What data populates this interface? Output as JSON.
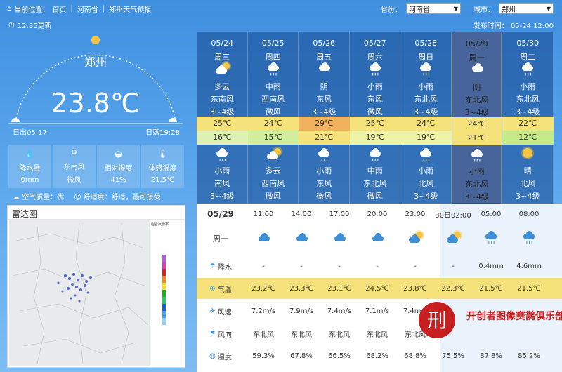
{
  "breadcrumb": {
    "prefix": "当前位置：",
    "items": [
      "首页",
      "河南省",
      "郑州天气预报"
    ]
  },
  "selectors": {
    "province_label": "省份：",
    "province_value": "河南省",
    "city_label": "城市：",
    "city_value": "郑州"
  },
  "updated": "12:35更新",
  "publish": "发布时间：  05-24 12:00",
  "current": {
    "city": "郑州",
    "temp": "23.8℃",
    "sunrise": "日出05:17",
    "sunset": "日落19:28"
  },
  "stats": [
    {
      "icon": "rain-drop-icon",
      "label": "降水量",
      "value": "0mm"
    },
    {
      "icon": "wind-icon",
      "label": "东南风",
      "value": "微风"
    },
    {
      "icon": "humidity-icon",
      "label": "相对湿度",
      "value": "41%"
    },
    {
      "icon": "thermometer-icon",
      "label": "体感温度",
      "value": "21.5℃"
    }
  ],
  "air": {
    "quality": "空气质量：优",
    "comfort": "舒适度：舒适，最可接受"
  },
  "radar": {
    "title": "雷达图"
  },
  "days": [
    {
      "date": "05/24",
      "week": "周三",
      "day_weather": "多云",
      "day_wind_dir": "东南风",
      "day_wind_lv": "3~4级",
      "high": "25℃",
      "low": "16℃",
      "night_weather": "小雨",
      "night_wind_dir": "南风",
      "night_wind_lv": "3~4级",
      "day_icon": "partly-cloudy-icon",
      "night_icon": "rain-icon",
      "high_color": "#f6e27a",
      "low_color": "#dff2b5"
    },
    {
      "date": "05/25",
      "week": "周四",
      "day_weather": "中雨",
      "day_wind_dir": "西南风",
      "day_wind_lv": "微风",
      "high": "24℃",
      "low": "15℃",
      "night_weather": "多云",
      "night_wind_dir": "西南风",
      "night_wind_lv": "微风",
      "day_icon": "rain-icon",
      "night_icon": "partly-cloudy-icon",
      "high_color": "#f6e27a",
      "low_color": "#cfeea0"
    },
    {
      "date": "05/26",
      "week": "周五",
      "day_weather": "阴",
      "day_wind_dir": "东风",
      "day_wind_lv": "3~4级",
      "high": "29℃",
      "low": "21℃",
      "night_weather": "小雨",
      "night_wind_dir": "东风",
      "night_wind_lv": "微风",
      "day_icon": "cloudy-icon",
      "night_icon": "rain-icon",
      "high_color": "#f2b15e",
      "low_color": "#f6e27a"
    },
    {
      "date": "05/27",
      "week": "周六",
      "day_weather": "小雨",
      "day_wind_dir": "东风",
      "day_wind_lv": "微风",
      "high": "25℃",
      "low": "19℃",
      "night_weather": "中雨",
      "night_wind_dir": "东北风",
      "night_wind_lv": "微风",
      "day_icon": "rain-icon",
      "night_icon": "rain-icon",
      "high_color": "#f6e27a",
      "low_color": "#eef3a8"
    },
    {
      "date": "05/28",
      "week": "周日",
      "day_weather": "小雨",
      "day_wind_dir": "东北风",
      "day_wind_lv": "3~4级",
      "high": "24℃",
      "low": "19℃",
      "night_weather": "小雨",
      "night_wind_dir": "北风",
      "night_wind_lv": "3~4级",
      "day_icon": "rain-icon",
      "night_icon": "rain-icon",
      "high_color": "#f6e27a",
      "low_color": "#eef3a8"
    },
    {
      "date": "05/29",
      "week": "周一",
      "day_weather": "阴",
      "day_wind_dir": "东北风",
      "day_wind_lv": "3~4级",
      "high": "24℃",
      "low": "21℃",
      "night_weather": "小雨",
      "night_wind_dir": "东北风",
      "night_wind_lv": "3~4级",
      "day_icon": "cloudy-icon",
      "night_icon": "rain-icon",
      "high_color": "#f6e27a",
      "low_color": "#f6e27a"
    },
    {
      "date": "05/30",
      "week": "周二",
      "day_weather": "小雨",
      "day_wind_dir": "东北风",
      "day_wind_lv": "3~4级",
      "high": "22℃",
      "low": "12℃",
      "night_weather": "晴",
      "night_wind_dir": "北风",
      "night_wind_lv": "3~4级",
      "day_icon": "rain-icon",
      "night_icon": "sun-icon",
      "high_color": "#f6e27a",
      "low_color": "#c4ea8c"
    }
  ],
  "hourly": {
    "date": "05/29",
    "week": "周一",
    "times": [
      "11:00",
      "14:00",
      "17:00",
      "20:00",
      "23:00",
      "30日02:00",
      "05:00",
      "08:00"
    ],
    "labels": {
      "rain": "降水",
      "temp": "气温",
      "wind_speed": "风速",
      "wind_dir": "风向",
      "humidity": "湿度"
    },
    "rain": [
      "-",
      "-",
      "-",
      "-",
      "-",
      "-",
      "0.4mm",
      "4.6mm"
    ],
    "temp": [
      "23.2℃",
      "23.3℃",
      "23.1℃",
      "24.5℃",
      "23.8℃",
      "22.3℃",
      "21.5℃",
      "21.5℃"
    ],
    "wind_speed": [
      "7.2m/s",
      "7.9m/s",
      "7.4m/s",
      "7.1m/s",
      "7.4m/s",
      "",
      "",
      ""
    ],
    "wind_dir": [
      "东北风",
      "东北风",
      "东北风",
      "东北风",
      "东北风",
      "",
      "",
      ""
    ],
    "humidity": [
      "59.3%",
      "67.8%",
      "66.5%",
      "68.2%",
      "68.8%",
      "75.5%",
      "87.8%",
      "85.2%"
    ]
  },
  "watermark": {
    "text": "开创者图像赛鹊俱乐部"
  }
}
